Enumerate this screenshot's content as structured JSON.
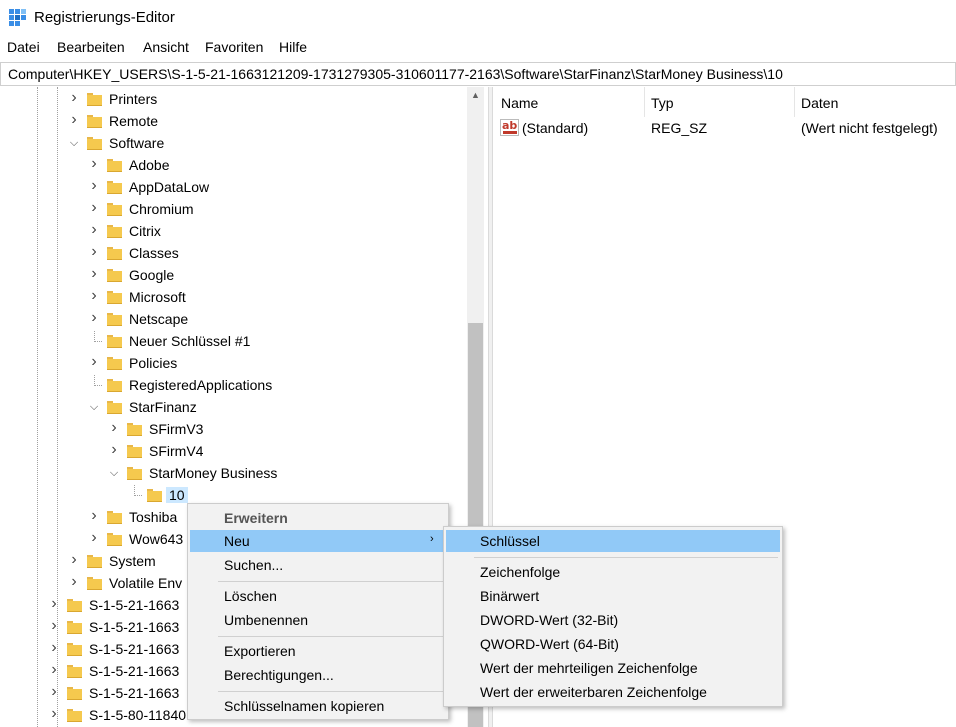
{
  "window": {
    "title": "Registrierungs-Editor",
    "icon": "regedit-icon"
  },
  "menubar": [
    "Datei",
    "Bearbeiten",
    "Ansicht",
    "Favoriten",
    "Hilfe"
  ],
  "address": "Computer\\HKEY_USERS\\S-1-5-21-1663121209-1731279305-310601177-2163\\Software\\StarFinanz\\StarMoney Business\\10",
  "tree": [
    {
      "label": "Printers",
      "state": "collapsed"
    },
    {
      "label": "Remote",
      "state": "collapsed"
    },
    {
      "label": "Software",
      "state": "expanded"
    },
    {
      "label": "Adobe",
      "state": "collapsed"
    },
    {
      "label": "AppDataLow",
      "state": "collapsed"
    },
    {
      "label": "Chromium",
      "state": "collapsed"
    },
    {
      "label": "Citrix",
      "state": "collapsed"
    },
    {
      "label": "Classes",
      "state": "collapsed"
    },
    {
      "label": "Google",
      "state": "collapsed"
    },
    {
      "label": "Microsoft",
      "state": "collapsed"
    },
    {
      "label": "Netscape",
      "state": "collapsed"
    },
    {
      "label": "Neuer Schlüssel #1",
      "state": "leaf"
    },
    {
      "label": "Policies",
      "state": "collapsed"
    },
    {
      "label": "RegisteredApplications",
      "state": "leaf"
    },
    {
      "label": "StarFinanz",
      "state": "expanded"
    },
    {
      "label": "SFirmV3",
      "state": "collapsed"
    },
    {
      "label": "SFirmV4",
      "state": "collapsed"
    },
    {
      "label": "StarMoney Business",
      "state": "expanded"
    },
    {
      "label": "10",
      "state": "selected"
    },
    {
      "label": "Toshiba",
      "state": "collapsed"
    },
    {
      "label": "Wow643",
      "state": "collapsed"
    },
    {
      "label": "System",
      "state": "collapsed"
    },
    {
      "label": "Volatile Env",
      "state": "collapsed"
    },
    {
      "label": "S-1-5-21-1663",
      "state": "collapsed"
    },
    {
      "label": "S-1-5-21-1663",
      "state": "collapsed"
    },
    {
      "label": "S-1-5-21-1663",
      "state": "collapsed"
    },
    {
      "label": "S-1-5-21-1663",
      "state": "collapsed"
    },
    {
      "label": "S-1-5-21-1663",
      "state": "collapsed"
    },
    {
      "label": "S-1-5-80-11840",
      "state": "collapsed"
    }
  ],
  "list": {
    "columns": [
      "Name",
      "Typ",
      "Daten"
    ],
    "rows": [
      {
        "name": "(Standard)",
        "type": "REG_SZ",
        "data": "(Wert nicht festgelegt)"
      }
    ]
  },
  "context_menu": {
    "items": [
      "Erweitern",
      "Neu",
      "Suchen...",
      "Löschen",
      "Umbenennen",
      "Exportieren",
      "Berechtigungen...",
      "Schlüsselnamen kopieren"
    ],
    "submenu_arrow": "›"
  },
  "submenu": {
    "items": [
      "Schlüssel",
      "Zeichenfolge",
      "Binärwert",
      "DWORD-Wert (32-Bit)",
      "QWORD-Wert (64-Bit)",
      "Wert der mehrteiligen Zeichenfolge",
      "Wert der erweiterbaren Zeichenfolge"
    ]
  },
  "colors": {
    "highlight": "#91c9f7",
    "selection": "#cce8ff",
    "folder": "#f5c94e"
  }
}
